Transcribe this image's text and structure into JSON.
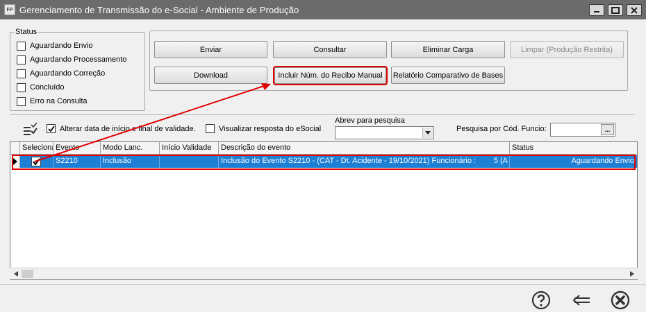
{
  "window": {
    "icon_text": "FP",
    "title": "Gerenciamento de Transmissão do e-Social - Ambiente de Produção"
  },
  "status": {
    "legend": "Status",
    "items": [
      {
        "label": "Aguardando Envio",
        "checked": false
      },
      {
        "label": "Aguardando Processamento",
        "checked": false
      },
      {
        "label": "Aguardando Correção",
        "checked": false
      },
      {
        "label": "Concluído",
        "checked": false
      },
      {
        "label": "Erro na Consulta",
        "checked": false
      }
    ]
  },
  "actions": {
    "enviar": "Enviar",
    "consultar": "Consultar",
    "eliminar_carga": "Eliminar Carga",
    "limpar": "Limpar (Produção Restrita)",
    "download": "Download",
    "incluir_recibo": "Incluir Núm. do Recibo Manual",
    "relatorio": "Relatório Comparativo de Bases"
  },
  "filters": {
    "alterar_data_label": "Alterar data de início e final de validade.",
    "alterar_data_checked": true,
    "visualizar_label": "Visualizar resposta do eSocial",
    "visualizar_checked": false,
    "abrev_label": "Abrev para pesquisa",
    "abrev_value": "",
    "pesquisa_label": "Pesquisa por Cód. Funcio:",
    "pesquisa_value": "",
    "pesquisa_btn": "..."
  },
  "grid": {
    "columns": [
      "Seleciona",
      "Evento",
      "Modo Lanc.",
      "Início Validade",
      "Descrição do evento",
      "Status"
    ],
    "rows": [
      {
        "selected": true,
        "evento": "S2210",
        "modo": "Inclusão",
        "inicio": "",
        "descricao": "Inclusão do Evento S2210 - (CAT - Dt. Acidente - 19/10/2021) Funcionário :",
        "descricao_extra": "5 (A",
        "status": "Aguardando Envio"
      }
    ]
  },
  "footer": {
    "help_icon": "question-circle-icon",
    "back_icon": "back-arrow-icon",
    "close_icon": "close-circle-icon"
  },
  "colors": {
    "titlebar": "#6b6b6b",
    "row_selected": "#1e80d4",
    "highlight": "#e00000"
  }
}
